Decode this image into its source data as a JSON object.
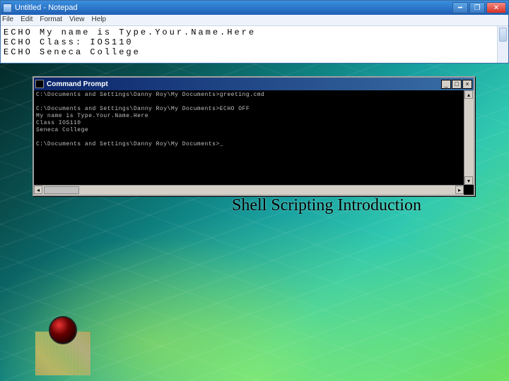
{
  "notepad": {
    "title": "Untitled - Notepad",
    "menu": {
      "file": "File",
      "edit": "Edit",
      "format": "Format",
      "view": "View",
      "help": "Help"
    },
    "lines": [
      "ECHO My name is Type.Your.Name.Here",
      "ECHO Class: IOS110",
      "ECHO Seneca College"
    ]
  },
  "cmd": {
    "title": "Command Prompt",
    "lines": [
      "C:\\Documents and Settings\\Danny Roy\\My Documents>greeting.cmd",
      "",
      "C:\\Documents and Settings\\Danny Roy\\My Documents>ECHO OFF",
      "My name is Type.Your.Name.Here",
      "Class IOS110",
      "Seneca College",
      "",
      "C:\\Documents and Settings\\Danny Roy\\My Documents>_"
    ]
  },
  "slide": {
    "title": "Shell Scripting Introduction"
  }
}
